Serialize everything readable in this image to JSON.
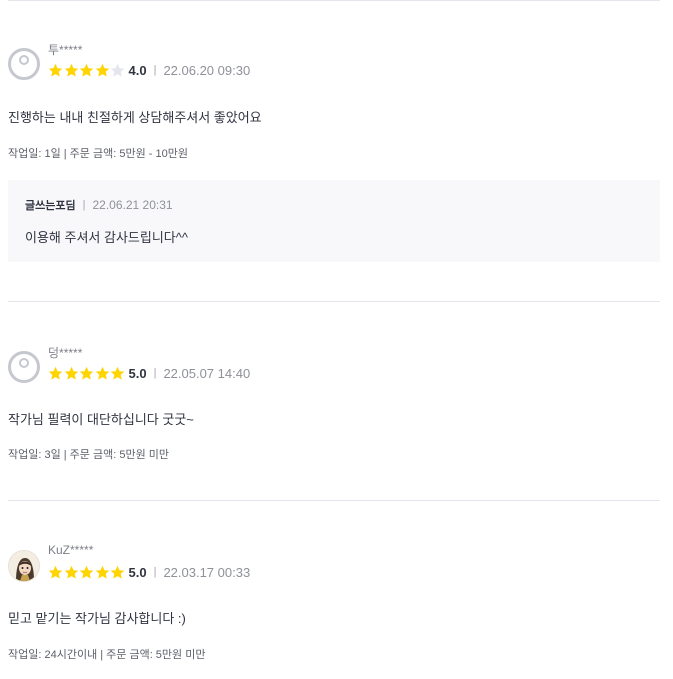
{
  "reviews": [
    {
      "nickname": "투*****",
      "rating": 4,
      "score_label": "4.0",
      "date": "22.06.20 09:30",
      "content": "진행하는 내내 친절하게 상담해주셔서 좋았어요",
      "detail": "작업일: 1일 | 주문 금액: 5만원 - 10만원",
      "avatar": "default-avatar-icon",
      "reply": {
        "author": "글쓰는포딤",
        "date": "22.06.21 20:31",
        "text": "이용해 주셔서 감사드립니다^^"
      }
    },
    {
      "nickname": "덩*****",
      "rating": 5,
      "score_label": "5.0",
      "date": "22.05.07 14:40",
      "content": "작가님 필력이 대단하십니다 굿굿~",
      "detail": "작업일: 3일 | 주문 금액: 5만원 미만",
      "avatar": "default-avatar-icon"
    },
    {
      "nickname": "KuZ*****",
      "rating": 5,
      "score_label": "5.0",
      "date": "22.03.17 00:33",
      "content": "믿고 맡기는 작가님 감사합니다 :)",
      "detail": "작업일: 24시간이내 | 주문 금액: 5만원 미만",
      "avatar": "user-photo-avatar"
    }
  ],
  "separator": "|",
  "colors": {
    "star_filled": "#ffd400",
    "star_empty": "#e4e5ed",
    "divider": "#e4e5ed",
    "reply_bg": "#f8f8fa"
  }
}
